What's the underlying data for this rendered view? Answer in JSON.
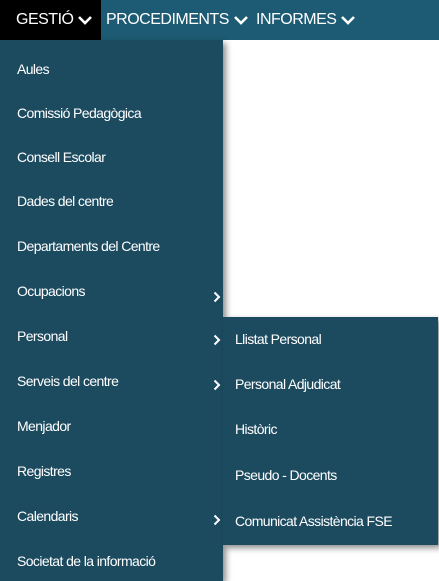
{
  "menubar": {
    "tabs": [
      {
        "label": "GESTIÓ",
        "active": true
      },
      {
        "label": "PROCEDIMENTS",
        "active": false
      },
      {
        "label": "INFORMES",
        "active": false
      }
    ]
  },
  "dropdown": {
    "items": [
      {
        "label": "Aules",
        "has_submenu": false
      },
      {
        "label": "Comissió Pedagògica",
        "has_submenu": false
      },
      {
        "label": "Consell Escolar",
        "has_submenu": false
      },
      {
        "label": "Dades del centre",
        "has_submenu": false
      },
      {
        "label": "Departaments del Centre",
        "has_submenu": false
      },
      {
        "label": "Ocupacions",
        "has_submenu": true
      },
      {
        "label": "Personal",
        "has_submenu": true
      },
      {
        "label": "Serveis del centre",
        "has_submenu": true
      },
      {
        "label": "Menjador",
        "has_submenu": false
      },
      {
        "label": "Registres",
        "has_submenu": false
      },
      {
        "label": "Calendaris",
        "has_submenu": true
      },
      {
        "label": "Societat de la informació",
        "has_submenu": false
      }
    ]
  },
  "submenu": {
    "parent": "Personal",
    "items": [
      {
        "label": "Llistat Personal"
      },
      {
        "label": "Personal Adjudicat"
      },
      {
        "label": "Històric"
      },
      {
        "label": "Pseudo - Docents"
      },
      {
        "label": "Comunicat Assistència FSE"
      }
    ]
  },
  "colors": {
    "menubar_bg": "#1c5b73",
    "active_tab_bg": "#000000",
    "menu_bg": "#1c4b60",
    "text": "#ffffff"
  },
  "icons": {
    "tab_chevron": "chevron-down-icon",
    "submenu_arrow": "chevron-right-icon"
  }
}
